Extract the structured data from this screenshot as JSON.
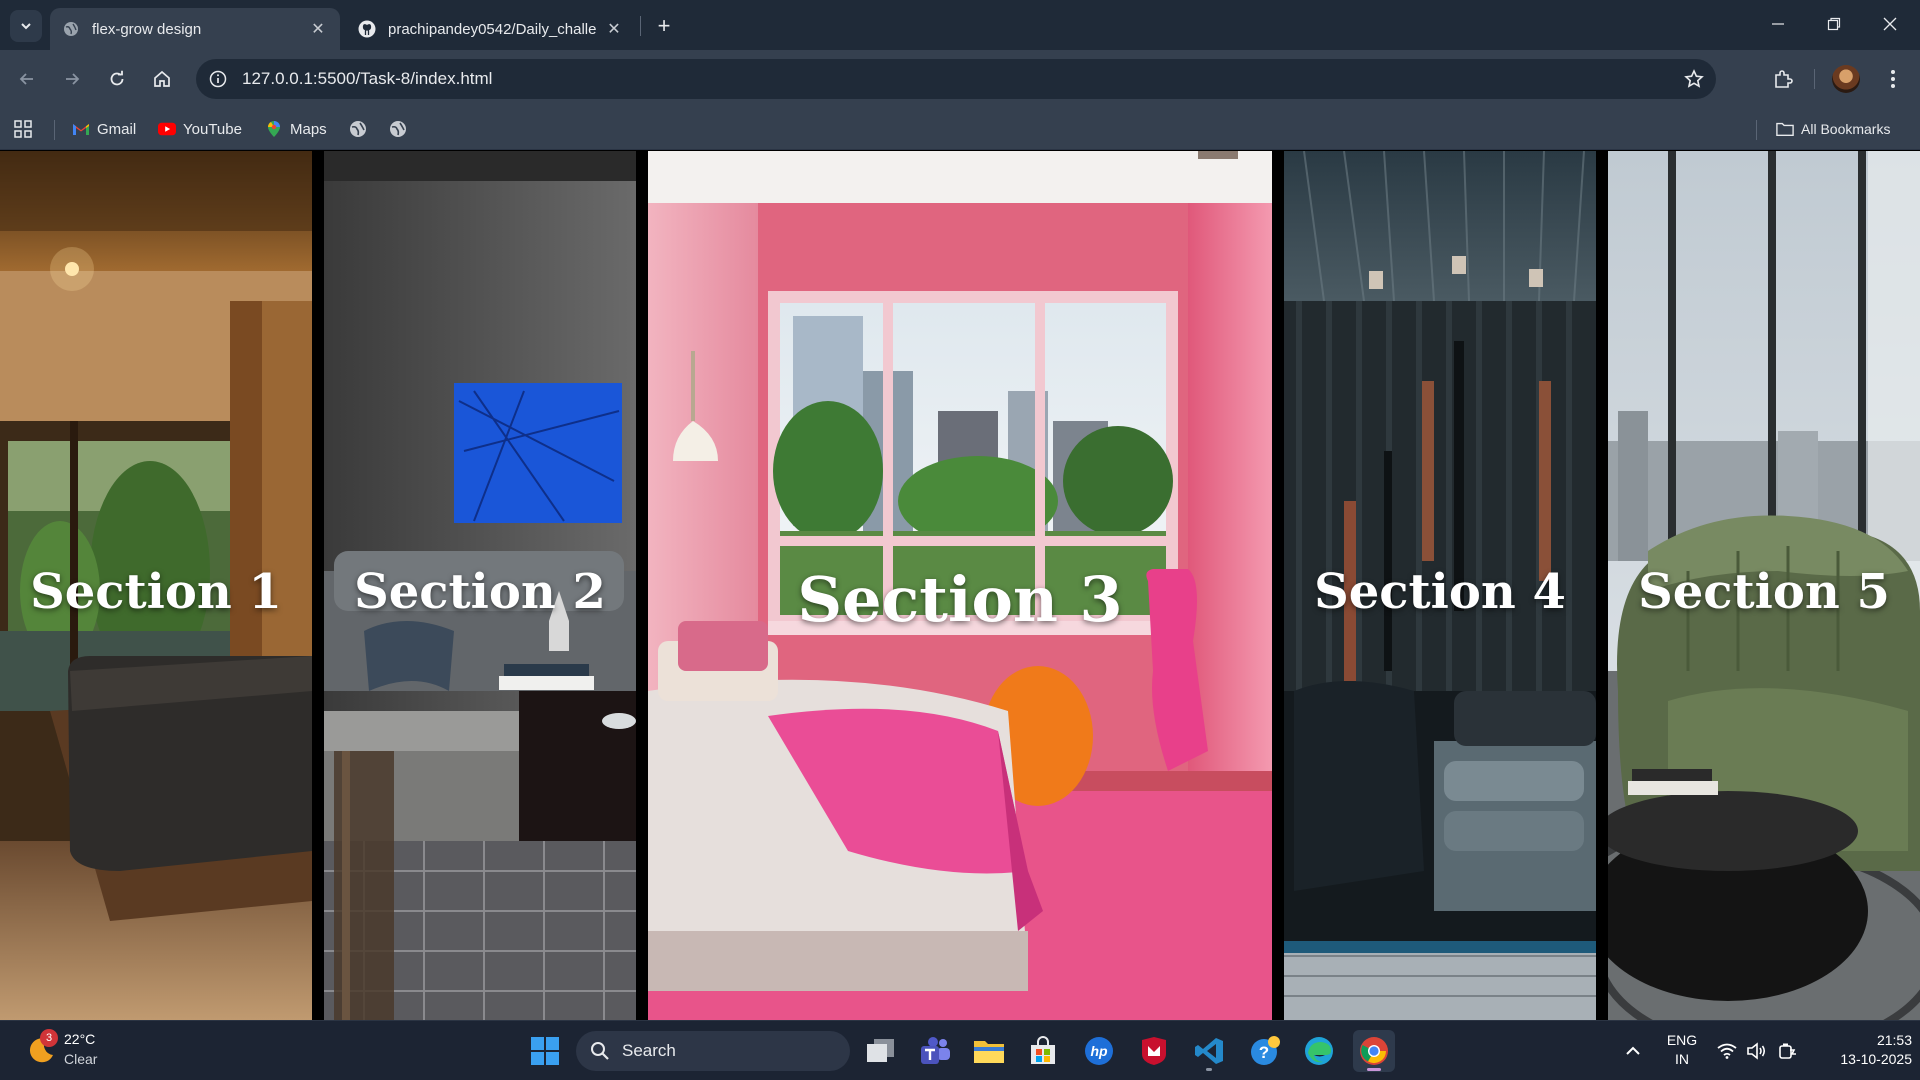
{
  "browser": {
    "tabs": [
      {
        "title": "flex-grow design",
        "active": true
      },
      {
        "title": "prachipandey0542/Daily_challe",
        "active": false
      }
    ],
    "address": "127.0.0.1:5500/Task-8/index.html",
    "bookmarks": [
      {
        "label": "Gmail",
        "icon": "gmail-icon"
      },
      {
        "label": "YouTube",
        "icon": "youtube-icon"
      },
      {
        "label": "Maps",
        "icon": "maps-icon"
      }
    ],
    "all_bookmarks_label": "All Bookmarks"
  },
  "page": {
    "sections": [
      {
        "label": "Section 1",
        "theme": "warm-wood-bedroom"
      },
      {
        "label": "Section 2",
        "theme": "grey-lounge"
      },
      {
        "label": "Section 3",
        "theme": "pink-bedroom"
      },
      {
        "label": "Section 4",
        "theme": "dark-bedroom"
      },
      {
        "label": "Section 5",
        "theme": "green-armchair"
      }
    ]
  },
  "taskbar": {
    "weather": {
      "temp": "22°C",
      "desc": "Clear",
      "badge": "3"
    },
    "search_label": "Search",
    "lang_line1": "ENG",
    "lang_line2": "IN",
    "time": "21:53",
    "date": "13-10-2025"
  },
  "colors": {
    "tab_strip": "#1f2a38",
    "toolbar": "#35404f",
    "taskbar": "#1c2433",
    "pink_accent": "#e0457a"
  }
}
